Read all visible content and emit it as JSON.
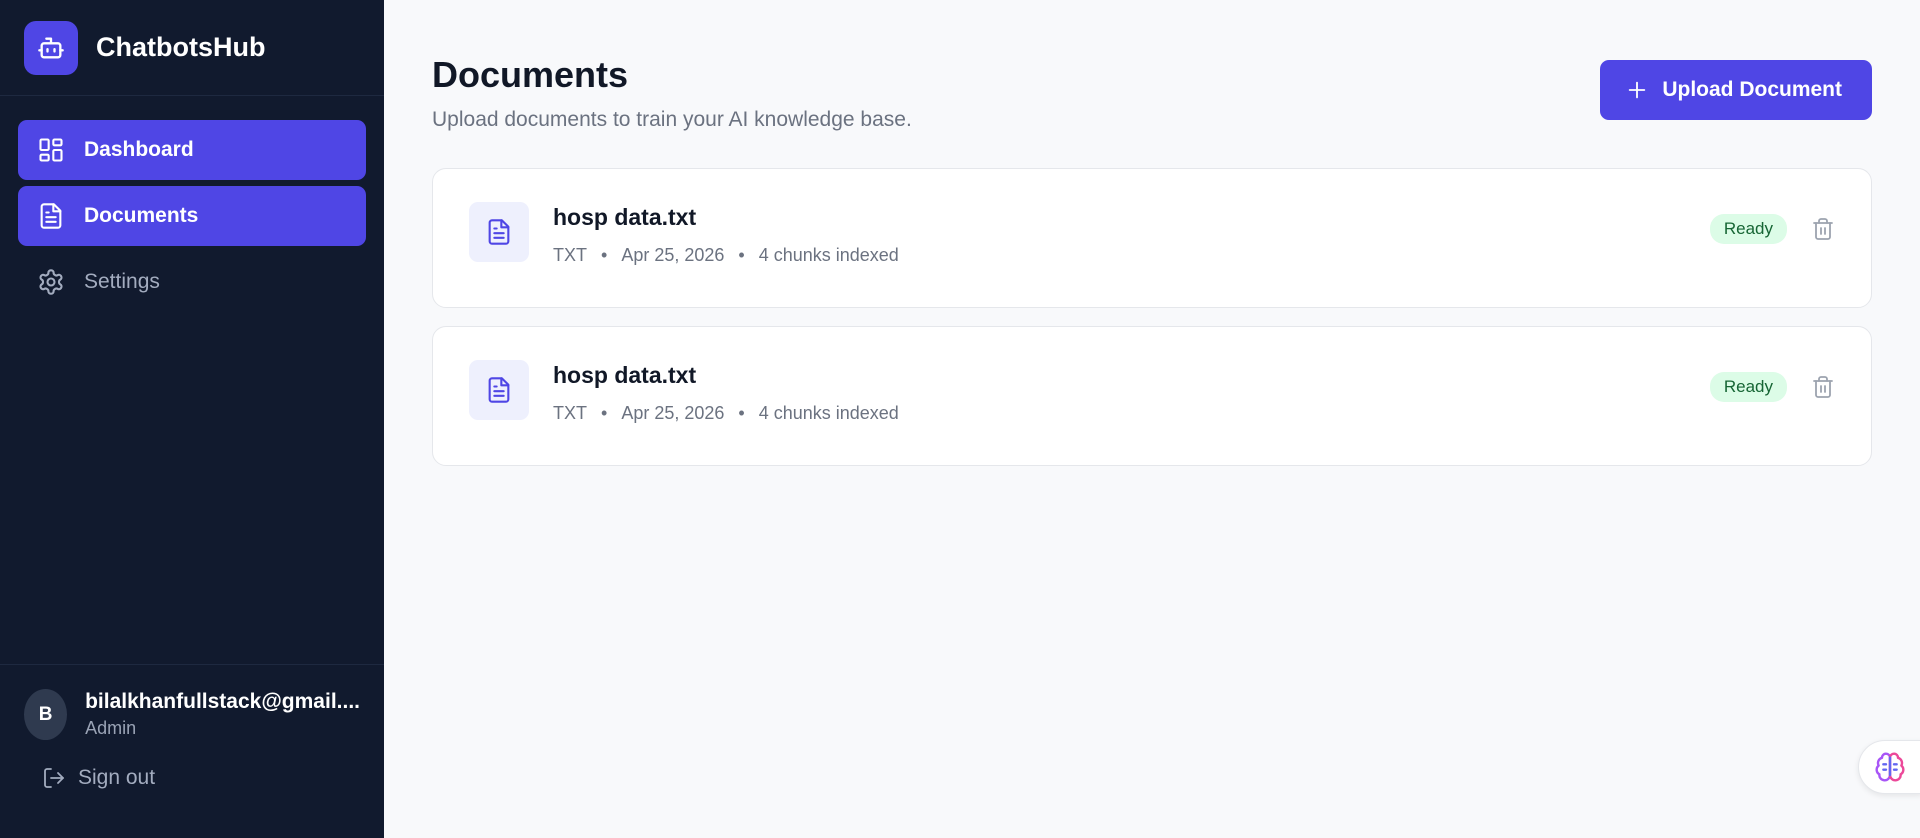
{
  "brand": {
    "name": "ChatbotsHub",
    "icon": "bot-icon"
  },
  "nav": [
    {
      "label": "Dashboard",
      "icon": "layout-grid-icon",
      "active": true
    },
    {
      "label": "Documents",
      "icon": "document-icon",
      "active": true
    },
    {
      "label": "Settings",
      "icon": "gear-icon",
      "active": false
    }
  ],
  "user": {
    "initial": "B",
    "email": "bilalkhanfullstack@gmail....",
    "role": "Admin",
    "signout_label": "Sign out"
  },
  "header": {
    "title": "Documents",
    "subtitle": "Upload documents to train your AI knowledge base.",
    "upload_label": "Upload Document"
  },
  "documents": [
    {
      "name": "hosp data.txt",
      "type": "TXT",
      "date": "Apr 25, 2026",
      "chunks": "4 chunks indexed",
      "status": "Ready"
    },
    {
      "name": "hosp data.txt",
      "type": "TXT",
      "date": "Apr 25, 2026",
      "chunks": "4 chunks indexed",
      "status": "Ready"
    }
  ],
  "colors": {
    "sidebar_bg": "#111a2e",
    "accent": "#4f46e5",
    "ready_badge_bg": "#dcfce7",
    "ready_badge_text": "#166534"
  },
  "meta_separator": "•"
}
